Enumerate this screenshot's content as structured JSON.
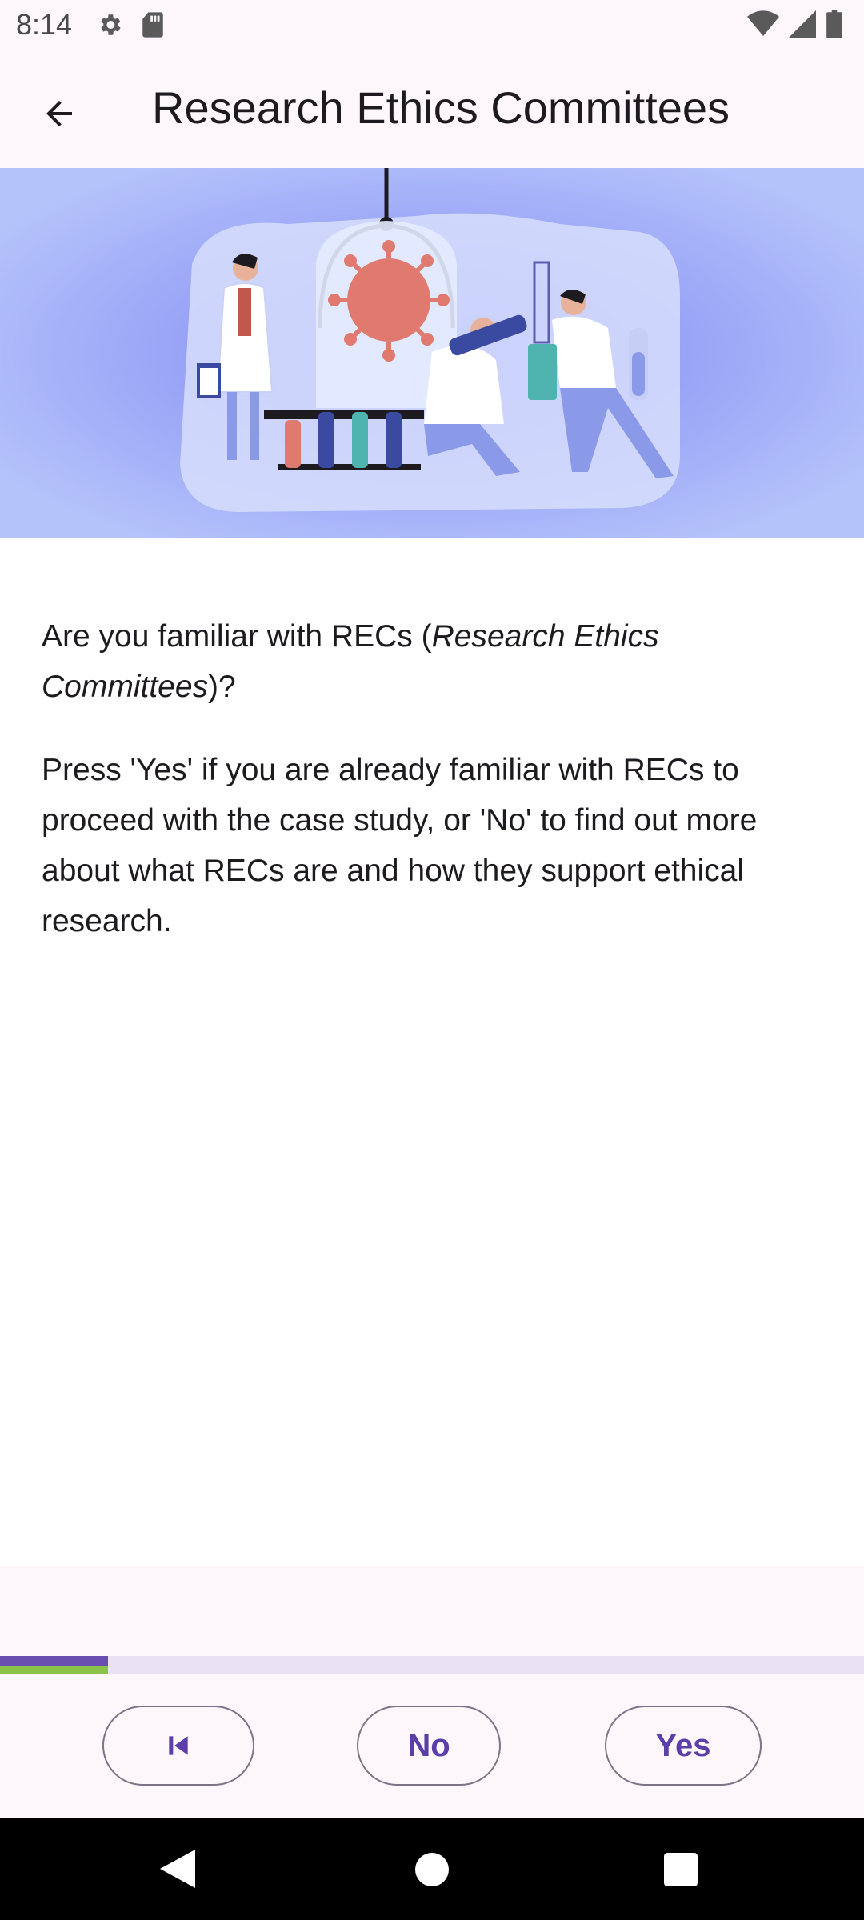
{
  "status_bar": {
    "time": "8:14",
    "icons_left": [
      "gear-icon",
      "sd-card-icon"
    ],
    "icons_right": [
      "wifi-icon",
      "signal-icon",
      "battery-icon"
    ]
  },
  "app_bar": {
    "title": "Research Ethics Committees",
    "back_icon": "arrow-back-icon"
  },
  "hero": {
    "description": "illustration of scientists studying a virus in a lab",
    "colors": {
      "background": "#a9b6fb",
      "accent": "#e07a6e"
    }
  },
  "content": {
    "question_prefix": "Are you familiar with RECs (",
    "question_italic": "Research Ethics Committees",
    "question_suffix": ")?",
    "instructions": "Press 'Yes' if you are already familiar with RECs to proceed with the case study, or 'No' to find out more about what RECs are and how they support ethical research."
  },
  "progress": {
    "value_fraction": 0.125,
    "colors": {
      "primary": "#6a4fb0",
      "secondary": "#8bc34a",
      "track": "#e9e2f3"
    }
  },
  "buttons": {
    "first_icon": "skip-previous-icon",
    "no_label": "No",
    "yes_label": "Yes"
  },
  "nav_bar": {
    "icons": [
      "nav-back-icon",
      "nav-home-icon",
      "nav-recents-icon"
    ]
  },
  "colors": {
    "accent": "#5b3ea8",
    "surface": "#fdf7fc",
    "outline": "#7b7486"
  }
}
